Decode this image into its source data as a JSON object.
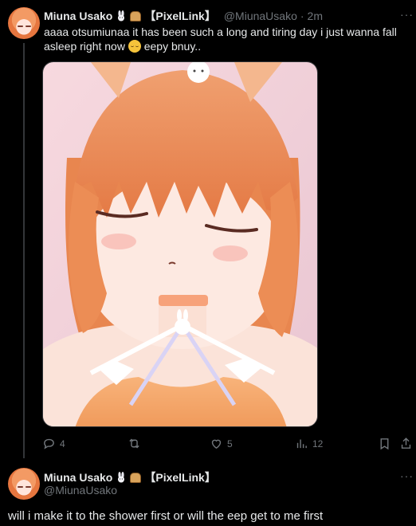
{
  "tweet1": {
    "display_name": "Miuna Usako",
    "tag": "【PixelLink】",
    "handle": "@MiunaUsako",
    "separator": "·",
    "time": "2m",
    "text_before_emoji": "aaaa otsumiunaa it has been such a long and tiring day i just wanna fall asleep right now",
    "emoji": "relieved-face-emoji",
    "text_after_emoji": "eepy bnuy..",
    "media_description_icon": "anime-bunny-girl-sleeping-image",
    "actions": {
      "replies": "4",
      "retweets": "",
      "likes": "5",
      "views": "12"
    }
  },
  "tweet2": {
    "display_name": "Miuna Usako",
    "tag": "【PixelLink】",
    "handle": "@MiunaUsako",
    "text": "will i make it to the shower first or will the eep get to me first"
  },
  "more_label": "···",
  "colors": {
    "background": "#000000",
    "text": "#e7e9ea",
    "muted": "#71767b",
    "thread_line": "#333639"
  }
}
